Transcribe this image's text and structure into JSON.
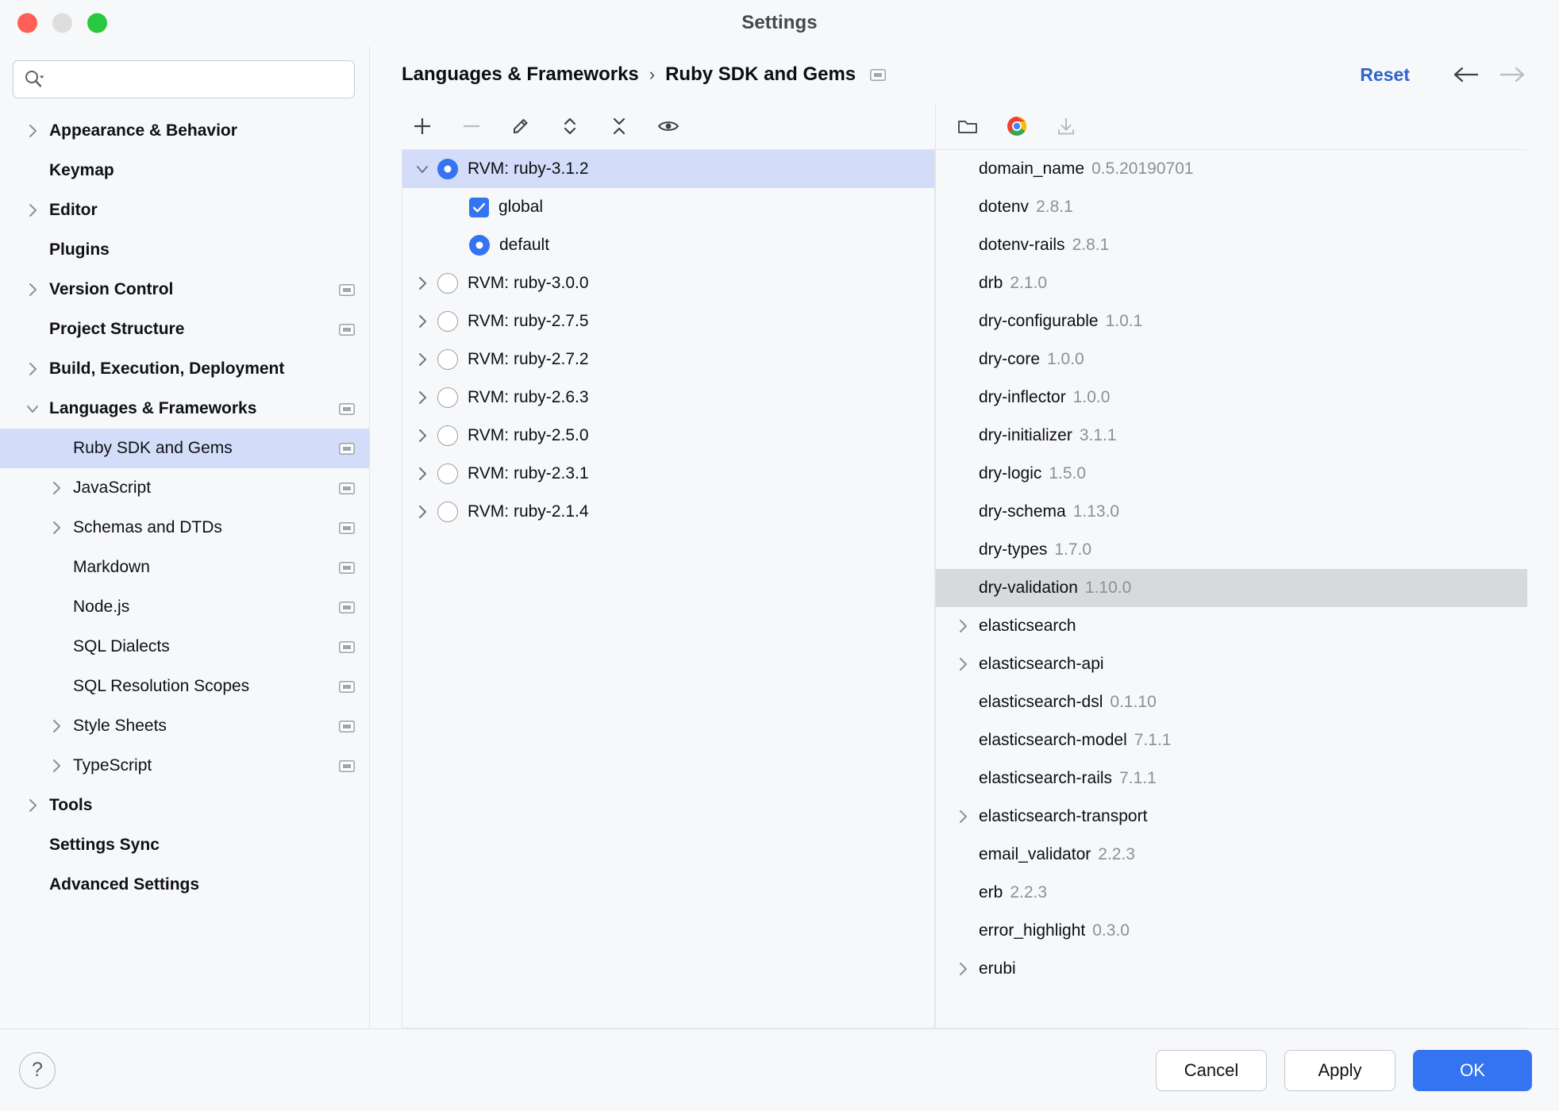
{
  "window": {
    "title": "Settings",
    "traffic_lights": [
      "close",
      "minimize",
      "zoom"
    ]
  },
  "sidebar": {
    "search": {
      "value": "",
      "placeholder": ""
    },
    "items": [
      {
        "label": "Appearance & Behavior",
        "level": 0,
        "expandable": true,
        "expanded": false,
        "badge": false,
        "selected": false
      },
      {
        "label": "Keymap",
        "level": 0,
        "expandable": false,
        "expanded": false,
        "badge": false,
        "selected": false
      },
      {
        "label": "Editor",
        "level": 0,
        "expandable": true,
        "expanded": false,
        "badge": false,
        "selected": false
      },
      {
        "label": "Plugins",
        "level": 0,
        "expandable": false,
        "expanded": false,
        "badge": false,
        "selected": false
      },
      {
        "label": "Version Control",
        "level": 0,
        "expandable": true,
        "expanded": false,
        "badge": true,
        "selected": false
      },
      {
        "label": "Project Structure",
        "level": 0,
        "expandable": false,
        "expanded": false,
        "badge": true,
        "selected": false
      },
      {
        "label": "Build, Execution, Deployment",
        "level": 0,
        "expandable": true,
        "expanded": false,
        "badge": false,
        "selected": false
      },
      {
        "label": "Languages & Frameworks",
        "level": 0,
        "expandable": true,
        "expanded": true,
        "badge": true,
        "selected": false
      },
      {
        "label": "Ruby SDK and Gems",
        "level": 1,
        "expandable": false,
        "expanded": false,
        "badge": true,
        "selected": true
      },
      {
        "label": "JavaScript",
        "level": 1,
        "expandable": true,
        "expanded": false,
        "badge": true,
        "selected": false
      },
      {
        "label": "Schemas and DTDs",
        "level": 1,
        "expandable": true,
        "expanded": false,
        "badge": true,
        "selected": false
      },
      {
        "label": "Markdown",
        "level": 1,
        "expandable": false,
        "expanded": false,
        "badge": true,
        "selected": false
      },
      {
        "label": "Node.js",
        "level": 1,
        "expandable": false,
        "expanded": false,
        "badge": true,
        "selected": false
      },
      {
        "label": "SQL Dialects",
        "level": 1,
        "expandable": false,
        "expanded": false,
        "badge": true,
        "selected": false
      },
      {
        "label": "SQL Resolution Scopes",
        "level": 1,
        "expandable": false,
        "expanded": false,
        "badge": true,
        "selected": false
      },
      {
        "label": "Style Sheets",
        "level": 1,
        "expandable": true,
        "expanded": false,
        "badge": true,
        "selected": false
      },
      {
        "label": "TypeScript",
        "level": 1,
        "expandable": true,
        "expanded": false,
        "badge": true,
        "selected": false
      },
      {
        "label": "Tools",
        "level": 0,
        "expandable": true,
        "expanded": false,
        "badge": false,
        "selected": false
      },
      {
        "label": "Settings Sync",
        "level": 0,
        "expandable": false,
        "expanded": false,
        "badge": false,
        "selected": false
      },
      {
        "label": "Advanced Settings",
        "level": 0,
        "expandable": false,
        "expanded": false,
        "badge": false,
        "selected": false
      }
    ]
  },
  "header": {
    "breadcrumb": [
      "Languages & Frameworks",
      "Ruby SDK and Gems"
    ],
    "separator": "›",
    "reset_label": "Reset",
    "back_enabled": true,
    "forward_enabled": false
  },
  "sdk_panel": {
    "toolbar": [
      {
        "name": "add-sdk-button",
        "icon": "plus-icon",
        "enabled": true
      },
      {
        "name": "remove-sdk-button",
        "icon": "minus-icon",
        "enabled": false
      },
      {
        "name": "edit-sdk-button",
        "icon": "pencil-icon",
        "enabled": true
      },
      {
        "name": "expand-all-button",
        "icon": "expand-all-icon",
        "enabled": true
      },
      {
        "name": "collapse-all-button",
        "icon": "collapse-all-icon",
        "enabled": true
      },
      {
        "name": "show-details-button",
        "icon": "eye-icon",
        "enabled": true
      }
    ],
    "rows": [
      {
        "label": "RVM: ruby-3.1.2",
        "level": 0,
        "expandable": true,
        "expanded": true,
        "control": "radio-on",
        "selected": true
      },
      {
        "label": "global",
        "level": 1,
        "expandable": false,
        "expanded": false,
        "control": "checkbox-on",
        "selected": false
      },
      {
        "label": "default",
        "level": 1,
        "expandable": false,
        "expanded": false,
        "control": "radio-on",
        "selected": false
      },
      {
        "label": "RVM: ruby-3.0.0",
        "level": 0,
        "expandable": true,
        "expanded": false,
        "control": "radio-off",
        "selected": false
      },
      {
        "label": "RVM: ruby-2.7.5",
        "level": 0,
        "expandable": true,
        "expanded": false,
        "control": "radio-off",
        "selected": false
      },
      {
        "label": "RVM: ruby-2.7.2",
        "level": 0,
        "expandable": true,
        "expanded": false,
        "control": "radio-off",
        "selected": false
      },
      {
        "label": "RVM: ruby-2.6.3",
        "level": 0,
        "expandable": true,
        "expanded": false,
        "control": "radio-off",
        "selected": false
      },
      {
        "label": "RVM: ruby-2.5.0",
        "level": 0,
        "expandable": true,
        "expanded": false,
        "control": "radio-off",
        "selected": false
      },
      {
        "label": "RVM: ruby-2.3.1",
        "level": 0,
        "expandable": true,
        "expanded": false,
        "control": "radio-off",
        "selected": false
      },
      {
        "label": "RVM: ruby-2.1.4",
        "level": 0,
        "expandable": true,
        "expanded": false,
        "control": "radio-off",
        "selected": false
      }
    ]
  },
  "gems_panel": {
    "toolbar": [
      {
        "name": "open-gem-folder-button",
        "icon": "folder-icon",
        "enabled": true
      },
      {
        "name": "open-in-browser-button",
        "icon": "chrome-icon",
        "enabled": true
      },
      {
        "name": "install-gem-button",
        "icon": "download-icon",
        "enabled": false
      }
    ],
    "rows": [
      {
        "name": "domain_name",
        "version": "0.5.20190701",
        "expandable": false,
        "selected": false
      },
      {
        "name": "dotenv",
        "version": "2.8.1",
        "expandable": false,
        "selected": false
      },
      {
        "name": "dotenv-rails",
        "version": "2.8.1",
        "expandable": false,
        "selected": false
      },
      {
        "name": "drb",
        "version": "2.1.0",
        "expandable": false,
        "selected": false
      },
      {
        "name": "dry-configurable",
        "version": "1.0.1",
        "expandable": false,
        "selected": false
      },
      {
        "name": "dry-core",
        "version": "1.0.0",
        "expandable": false,
        "selected": false
      },
      {
        "name": "dry-inflector",
        "version": "1.0.0",
        "expandable": false,
        "selected": false
      },
      {
        "name": "dry-initializer",
        "version": "3.1.1",
        "expandable": false,
        "selected": false
      },
      {
        "name": "dry-logic",
        "version": "1.5.0",
        "expandable": false,
        "selected": false
      },
      {
        "name": "dry-schema",
        "version": "1.13.0",
        "expandable": false,
        "selected": false
      },
      {
        "name": "dry-types",
        "version": "1.7.0",
        "expandable": false,
        "selected": false
      },
      {
        "name": "dry-validation",
        "version": "1.10.0",
        "expandable": false,
        "selected": true
      },
      {
        "name": "elasticsearch",
        "version": "",
        "expandable": true,
        "selected": false
      },
      {
        "name": "elasticsearch-api",
        "version": "",
        "expandable": true,
        "selected": false
      },
      {
        "name": "elasticsearch-dsl",
        "version": "0.1.10",
        "expandable": false,
        "selected": false
      },
      {
        "name": "elasticsearch-model",
        "version": "7.1.1",
        "expandable": false,
        "selected": false
      },
      {
        "name": "elasticsearch-rails",
        "version": "7.1.1",
        "expandable": false,
        "selected": false
      },
      {
        "name": "elasticsearch-transport",
        "version": "",
        "expandable": true,
        "selected": false
      },
      {
        "name": "email_validator",
        "version": "2.2.3",
        "expandable": false,
        "selected": false
      },
      {
        "name": "erb",
        "version": "2.2.3",
        "expandable": false,
        "selected": false
      },
      {
        "name": "error_highlight",
        "version": "0.3.0",
        "expandable": false,
        "selected": false
      },
      {
        "name": "erubi",
        "version": "",
        "expandable": true,
        "selected": false
      }
    ]
  },
  "footer": {
    "help_label": "?",
    "cancel_label": "Cancel",
    "apply_label": "Apply",
    "ok_label": "OK"
  },
  "colors": {
    "accent": "#3574f0",
    "selection_active": "#d3ddf9",
    "selection_inactive": "#d8d9dc",
    "link": "#2e62cd",
    "muted_text": "#8b9098",
    "window_bg": "#f7f8fa"
  }
}
